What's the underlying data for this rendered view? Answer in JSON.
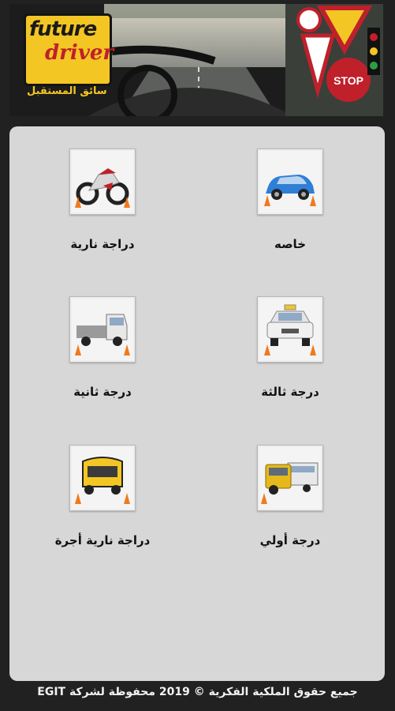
{
  "banner": {
    "logo_line1": "future",
    "logo_line2": "driver",
    "logo_arabic": "سائق المستقبل",
    "sign_text": "STOP"
  },
  "categories": [
    {
      "label": "خاصه",
      "icon": "private-car-icon"
    },
    {
      "label": "دراجة نارية",
      "icon": "motorcycle-icon"
    },
    {
      "label": "درجة ثالثة",
      "icon": "taxi-icon"
    },
    {
      "label": "درجة ثانية",
      "icon": "truck-icon"
    },
    {
      "label": "درجة أولي",
      "icon": "truck-bus-icon"
    },
    {
      "label": "دراجة نارية أجرة",
      "icon": "tuktuk-icon"
    }
  ],
  "footer": {
    "copyright": "جميع حقوق الملكية الفكرية © 2019 محفوظة لشركة EGIT"
  },
  "colors": {
    "background": "#212121",
    "panel": "#d7d7d7",
    "logo_yellow": "#f3c623",
    "logo_red": "#c0202a"
  }
}
